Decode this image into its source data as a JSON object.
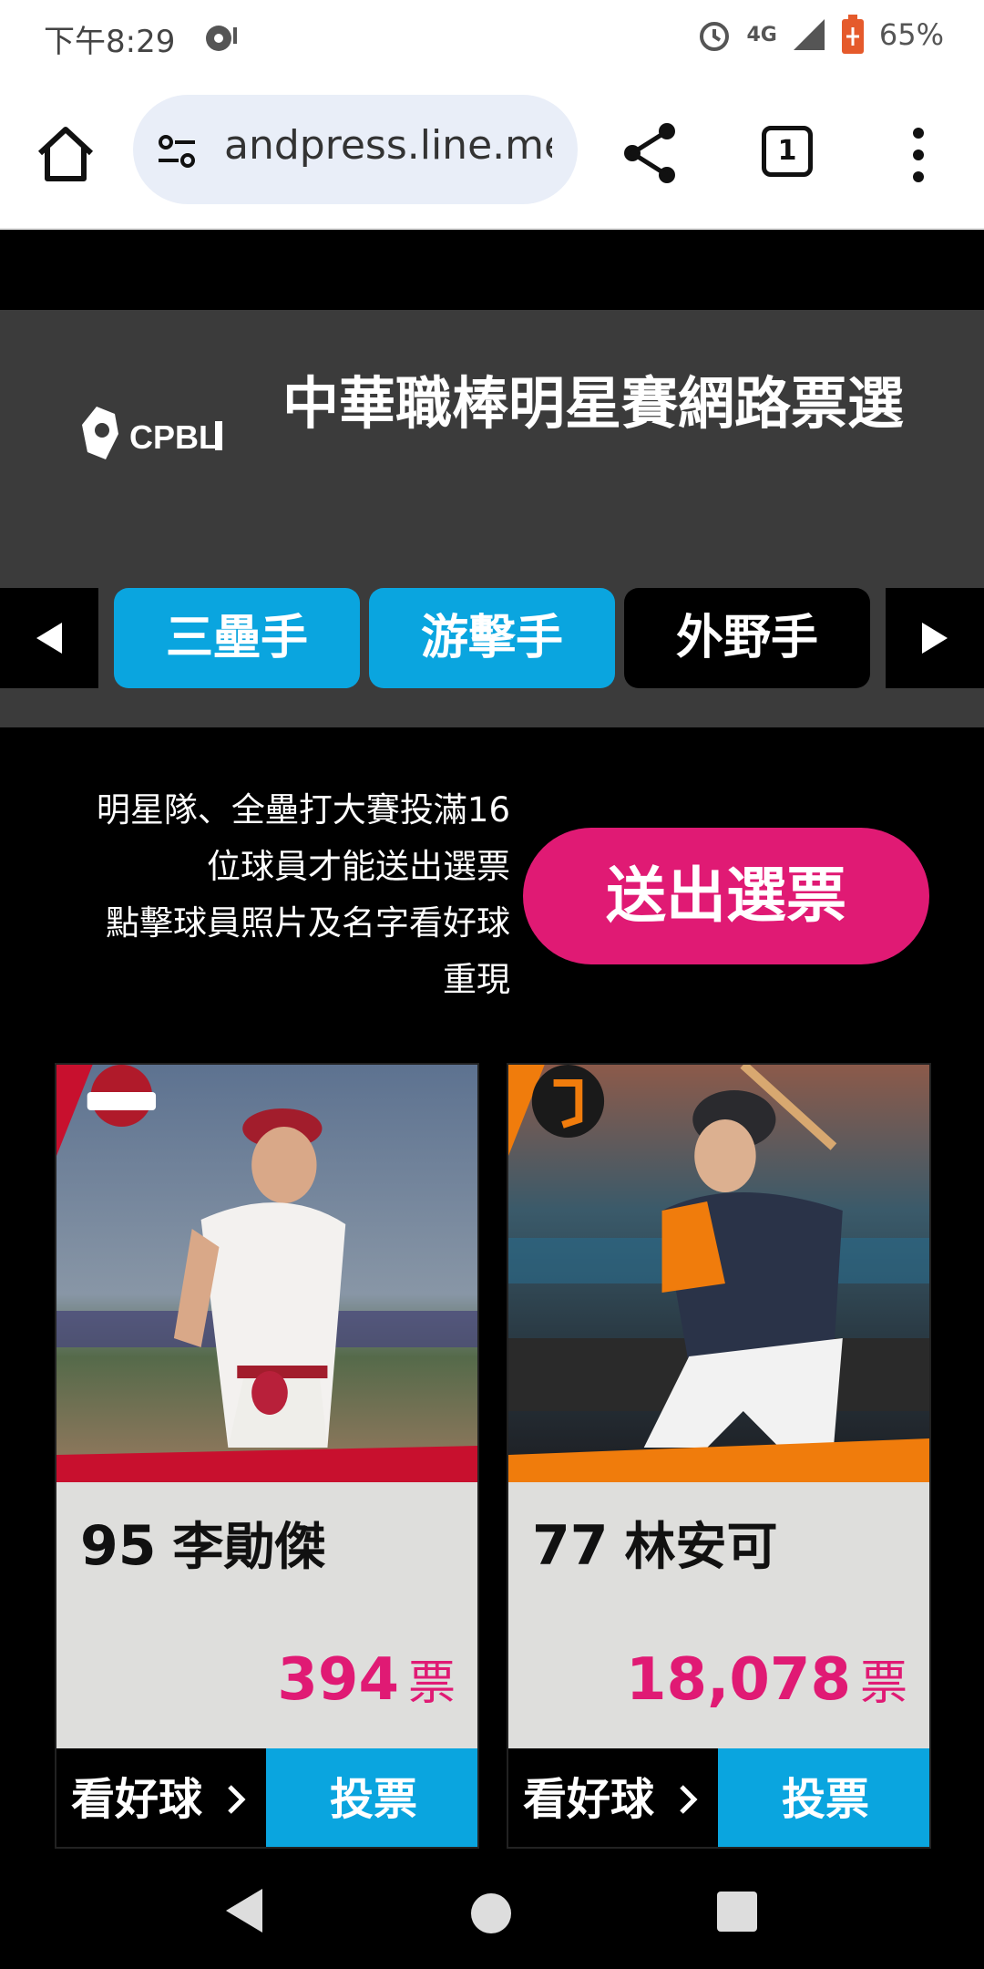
{
  "status_bar": {
    "time": "下午8:29",
    "network": "4G",
    "battery": "65%"
  },
  "browser": {
    "url": "andpress.line.me",
    "tab_count": "1"
  },
  "header": {
    "logo_text": "CPBL",
    "title": "中華職棒明星賽網路票選"
  },
  "position_tabs": [
    {
      "label": "三壘手",
      "active": true
    },
    {
      "label": "游擊手",
      "active": true
    },
    {
      "label": "外野手",
      "active": false
    }
  ],
  "notice": {
    "line1": "明星隊、全壘打大賽投滿16",
    "line2": "位球員才能送出選票",
    "line3": "點擊球員照片及名字看好球",
    "line4": "重現"
  },
  "submit_label": "送出選票",
  "players": [
    {
      "number": "95",
      "name": "李勛傑",
      "votes": "394",
      "vote_unit": "票",
      "team_color": "#c8102e",
      "replay_label": "看好球",
      "vote_label": "投票"
    },
    {
      "number": "77",
      "name": "林安可",
      "votes": "18,078",
      "vote_unit": "票",
      "team_color": "#f07c0c",
      "replay_label": "看好球",
      "vote_label": "投票"
    }
  ],
  "colors": {
    "accent_pink": "#e01a74",
    "accent_blue": "#0aa5df",
    "header_gray": "#3b3b3b"
  }
}
